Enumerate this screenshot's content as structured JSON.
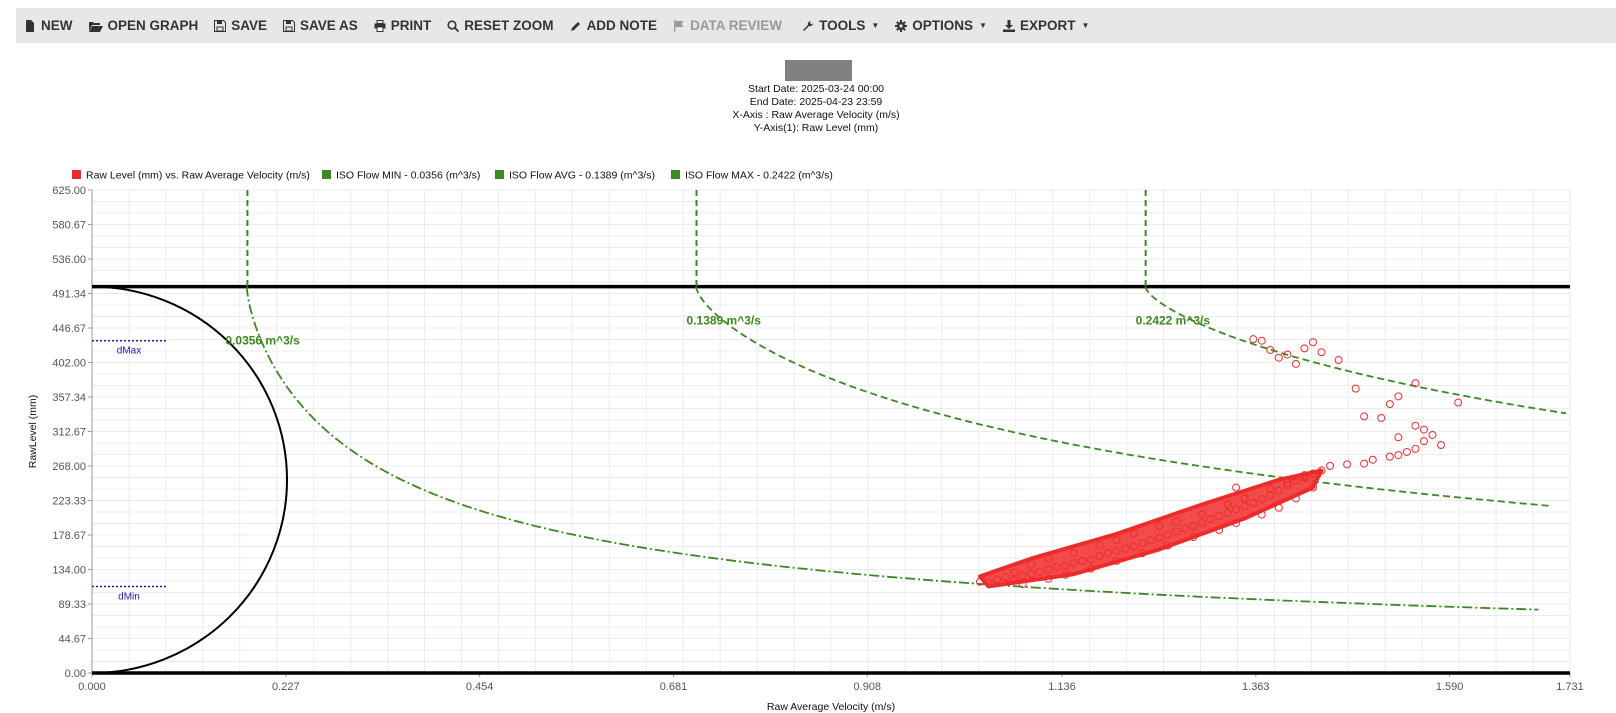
{
  "toolbar": {
    "new": "NEW",
    "open_graph": "OPEN GRAPH",
    "save": "SAVE",
    "save_as": "SAVE AS",
    "print": "PRINT",
    "reset_zoom": "RESET ZOOM",
    "add_note": "ADD NOTE",
    "data_review": "DATA REVIEW",
    "tools": "TOOLS",
    "options": "OPTIONS",
    "export": "EXPORT"
  },
  "header": {
    "start_date": "Start Date: 2025-03-24 00:00",
    "end_date": "End Date: 2025-04-23 23:59",
    "x_axis": "X-Axis : Raw Average Velocity (m/s)",
    "y_axis": "Y-Axis(1): Raw Level (mm)"
  },
  "colors": {
    "scatter": "#ee2b2b",
    "iso": "#3a8a1e",
    "pipe": "#000000",
    "markers": "#1a1acc"
  },
  "chart_data": {
    "type": "scatter",
    "xlabel": "Raw Average Velocity (m/s)",
    "ylabel": "RawLevel (mm)",
    "xlim": [
      0,
      1.731
    ],
    "ylim": [
      0,
      625
    ],
    "x_ticks": [
      "0.000",
      "0.227",
      "0.454",
      "0.681",
      "0.908",
      "1.136",
      "1.363",
      "1.590",
      "1.731"
    ],
    "y_ticks": [
      "0.00",
      "44.67",
      "89.33",
      "134.00",
      "178.67",
      "223.33",
      "268.00",
      "312.67",
      "357.34",
      "402.00",
      "446.67",
      "491.34",
      "536.00",
      "580.67",
      "625.00"
    ],
    "grid": true,
    "legend_position": "top-left",
    "legend": [
      {
        "name": "Raw Level (mm) vs. Raw Average Velocity (m/s)",
        "color": "#ee2b2b"
      },
      {
        "name": "ISO Flow MIN - 0.0356 (m^3/s)",
        "color": "#3a8a1e"
      },
      {
        "name": "ISO Flow AVG - 0.1389 (m^3/s)",
        "color": "#3a8a1e"
      },
      {
        "name": "ISO Flow MAX - 0.2422 (m^3/s)",
        "color": "#3a8a1e"
      }
    ],
    "pipe_diameter": 500,
    "iso_flows": [
      {
        "label": "0.0356 m^3/s",
        "flow": 0.0356,
        "vertical_x": 0.182
      },
      {
        "label": "0.1389 m^3/s",
        "flow": 0.1389,
        "vertical_x": 0.708
      },
      {
        "label": "0.2422 m^3/s",
        "flow": 0.2422,
        "vertical_x": 1.234
      }
    ],
    "markers": [
      {
        "label": "dMax",
        "y": 430
      },
      {
        "label": "dMin",
        "y": 112
      }
    ],
    "scatter_points": [
      [
        1.04,
        118
      ],
      [
        1.05,
        117
      ],
      [
        1.06,
        121
      ],
      [
        1.07,
        124
      ],
      [
        1.08,
        120
      ],
      [
        1.09,
        126
      ],
      [
        1.1,
        128
      ],
      [
        1.11,
        131
      ],
      [
        1.12,
        134
      ],
      [
        1.13,
        137
      ],
      [
        1.14,
        139
      ],
      [
        1.15,
        142
      ],
      [
        1.16,
        145
      ],
      [
        1.17,
        147
      ],
      [
        1.18,
        151
      ],
      [
        1.19,
        155
      ],
      [
        1.2,
        158
      ],
      [
        1.21,
        161
      ],
      [
        1.22,
        164
      ],
      [
        1.23,
        168
      ],
      [
        1.24,
        172
      ],
      [
        1.25,
        175
      ],
      [
        1.26,
        179
      ],
      [
        1.27,
        183
      ],
      [
        1.28,
        187
      ],
      [
        1.29,
        190
      ],
      [
        1.3,
        194
      ],
      [
        1.31,
        199
      ],
      [
        1.32,
        203
      ],
      [
        1.33,
        207
      ],
      [
        1.34,
        212
      ],
      [
        1.35,
        216
      ],
      [
        1.36,
        220
      ],
      [
        1.37,
        225
      ],
      [
        1.38,
        230
      ],
      [
        1.39,
        236
      ],
      [
        1.4,
        243
      ],
      [
        1.41,
        249
      ],
      [
        1.42,
        254
      ],
      [
        1.43,
        258
      ],
      [
        1.44,
        262
      ],
      [
        1.08,
        130
      ],
      [
        1.1,
        140
      ],
      [
        1.12,
        148
      ],
      [
        1.15,
        155
      ],
      [
        1.18,
        165
      ],
      [
        1.2,
        172
      ],
      [
        1.22,
        180
      ],
      [
        1.25,
        190
      ],
      [
        1.27,
        196
      ],
      [
        1.3,
        205
      ],
      [
        1.33,
        218
      ],
      [
        1.35,
        226
      ],
      [
        1.38,
        238
      ],
      [
        1.4,
        246
      ],
      [
        1.42,
        256
      ],
      [
        1.09,
        115
      ],
      [
        1.12,
        122
      ],
      [
        1.14,
        127
      ],
      [
        1.17,
        135
      ],
      [
        1.2,
        145
      ],
      [
        1.23,
        155
      ],
      [
        1.26,
        165
      ],
      [
        1.29,
        176
      ],
      [
        1.32,
        185
      ],
      [
        1.34,
        194
      ],
      [
        1.37,
        205
      ],
      [
        1.39,
        214
      ],
      [
        1.41,
        226
      ],
      [
        1.43,
        240
      ],
      [
        1.34,
        240
      ],
      [
        1.45,
        268
      ],
      [
        1.47,
        270
      ],
      [
        1.49,
        271
      ],
      [
        1.5,
        276
      ],
      [
        1.52,
        280
      ],
      [
        1.53,
        282
      ],
      [
        1.54,
        286
      ],
      [
        1.55,
        290
      ],
      [
        1.56,
        300
      ],
      [
        1.57,
        308
      ],
      [
        1.58,
        295
      ],
      [
        1.55,
        320
      ],
      [
        1.56,
        315
      ],
      [
        1.53,
        305
      ],
      [
        1.51,
        330
      ],
      [
        1.52,
        348
      ],
      [
        1.53,
        358
      ],
      [
        1.55,
        375
      ],
      [
        1.49,
        332
      ],
      [
        1.48,
        368
      ],
      [
        1.46,
        405
      ],
      [
        1.44,
        415
      ],
      [
        1.42,
        420
      ],
      [
        1.4,
        412
      ],
      [
        1.38,
        418
      ],
      [
        1.37,
        430
      ],
      [
        1.39,
        408
      ],
      [
        1.41,
        400
      ],
      [
        1.36,
        432
      ],
      [
        1.43,
        428
      ],
      [
        1.6,
        350
      ]
    ]
  }
}
